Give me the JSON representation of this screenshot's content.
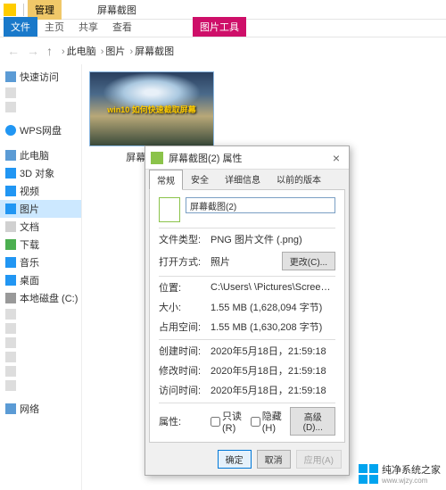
{
  "titlebar": {
    "context_tab": "管理",
    "window_title": "屏幕截图"
  },
  "ribbon": {
    "file": "文件",
    "home": "主页",
    "share": "共享",
    "view": "查看",
    "pic_tools": "图片工具"
  },
  "addr": {
    "root": "此电脑",
    "p1": "图片",
    "p2": "屏幕截图"
  },
  "sidebar": {
    "quick": "快速访问",
    "wps": "WPS网盘",
    "pc": "此电脑",
    "d3": "3D 对象",
    "video": "视频",
    "pic": "图片",
    "doc": "文档",
    "dl": "下载",
    "music": "音乐",
    "desk": "桌面",
    "diskC": "本地磁盘 (C:)",
    "net": "网络"
  },
  "thumb": {
    "caption": "屏幕截图(2)",
    "overlay": "win10 如何快速截取屏幕"
  },
  "dialog": {
    "title": "屏幕截图(2) 属性",
    "tabs": {
      "general": "常规",
      "security": "安全",
      "details": "详细信息",
      "prev": "以前的版本"
    },
    "filename": "屏幕截图(2)",
    "rows": {
      "type_l": "文件类型:",
      "type_v": "PNG 图片文件 (.png)",
      "open_l": "打开方式:",
      "open_v": "照片",
      "change": "更改(C)...",
      "loc_l": "位置:",
      "loc_v": "C:\\Users\\      \\Pictures\\Screenshots",
      "size_l": "大小:",
      "size_v": "1.55 MB (1,628,094 字节)",
      "disk_l": "占用空间:",
      "disk_v": "1.55 MB (1,630,208 字节)",
      "created_l": "创建时间:",
      "created_v": "2020年5月18日，21:59:18",
      "mod_l": "修改时间:",
      "mod_v": "2020年5月18日，21:59:18",
      "acc_l": "访问时间:",
      "acc_v": "2020年5月18日，21:59:18",
      "attr_l": "属性:",
      "ro": "只读(R)",
      "hidden": "隐藏(H)",
      "adv": "高级(D)..."
    },
    "buttons": {
      "ok": "确定",
      "cancel": "取消",
      "apply": "应用(A)"
    }
  },
  "watermark": {
    "name": "纯净系统之家",
    "url": "www.wjzy.com"
  }
}
